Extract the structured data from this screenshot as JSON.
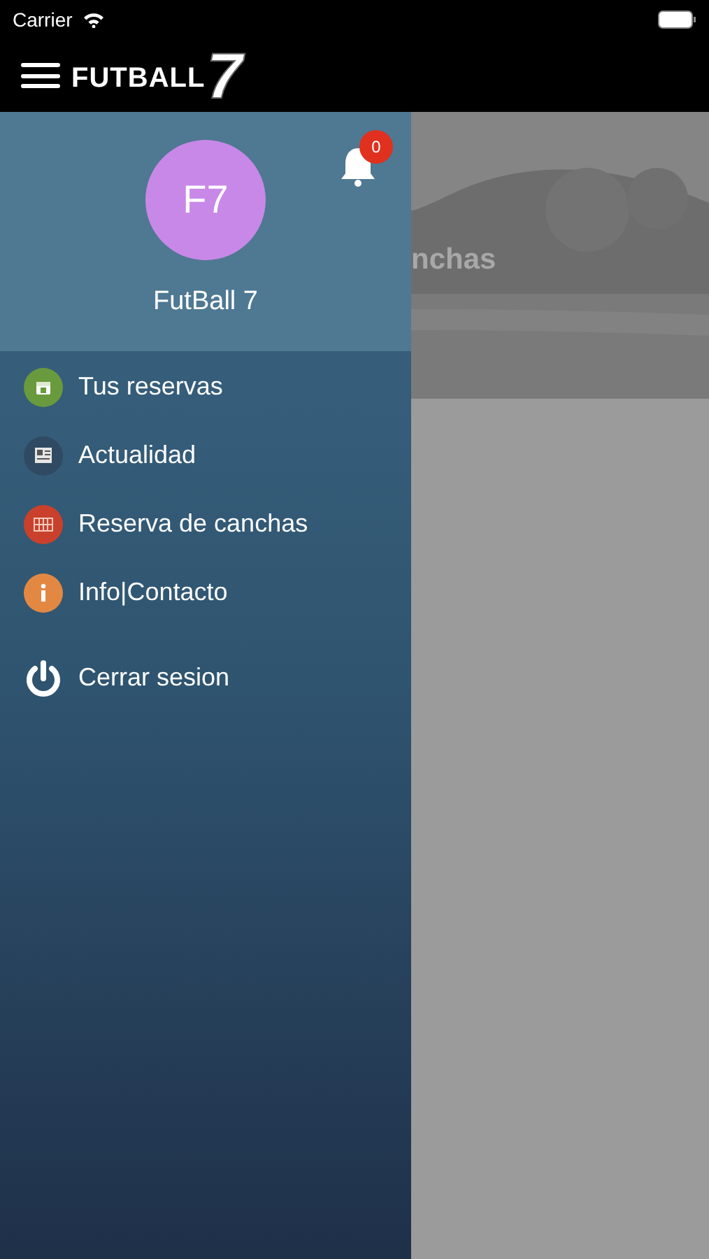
{
  "status_bar": {
    "carrier": "Carrier"
  },
  "nav_bar": {
    "logo_text": "FUTBALL",
    "logo_number": "7"
  },
  "background": {
    "hero_title": "nchas"
  },
  "drawer": {
    "avatar": "F7",
    "user_name": "FutBall 7",
    "notifications": "0",
    "items": [
      {
        "label": "Tus reservas",
        "kind": "calendar",
        "color": "#6a9a3e"
      },
      {
        "label": "Actualidad",
        "kind": "news",
        "color": "#2f4a62"
      },
      {
        "label": "Reserva de canchas",
        "kind": "grid",
        "color": "#c9412c"
      },
      {
        "label": "Info|Contacto",
        "kind": "info",
        "color": "#e38843"
      }
    ],
    "logout": {
      "label": "Cerrar sesion"
    }
  }
}
